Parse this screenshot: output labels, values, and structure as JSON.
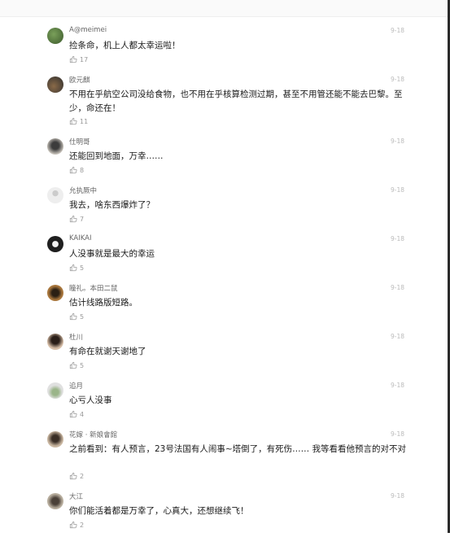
{
  "colors": {
    "like_icon": "#999999",
    "date": "#bbbbbb"
  },
  "comments": [
    {
      "user": "A@meimei",
      "date": "9-18",
      "text": "捡条命，机上人都太幸运啦！",
      "likes": "17",
      "avatar_colors": [
        "#7aa05a",
        "#3c5a2c"
      ]
    },
    {
      "user": "欧元麒",
      "date": "9-18",
      "text": "不用在乎航空公司没给食物，也不用在乎核算检测过期，甚至不用管还能不能去巴黎。至少，命还在！",
      "likes": "11",
      "avatar_colors": [
        "#2d2d2d",
        "#8a6a48"
      ]
    },
    {
      "user": "仕明哥",
      "date": "9-18",
      "text": "还能回到地面，万幸……",
      "likes": "8",
      "avatar_colors": [
        "#c8c3bb",
        "#3c3c3c"
      ]
    },
    {
      "user": "允执厥中",
      "date": "9-18",
      "text": "我去，啥东西爆炸了？",
      "likes": "7",
      "avatar_colors": [
        "#eeeeee",
        "#cccccc"
      ]
    },
    {
      "user": "KAIKAI",
      "date": "9-18",
      "text": "人没事就是最大的幸运",
      "likes": "5",
      "avatar_colors": [
        "#1f1f1f",
        "#f4f4f4"
      ]
    },
    {
      "user": "瞳礼。本田二鼠",
      "date": "9-18",
      "text": "估计线路版短路。",
      "likes": "5",
      "avatar_colors": [
        "#a8763c",
        "#2b2014"
      ]
    },
    {
      "user": "杜川",
      "date": "9-18",
      "text": "有命在就谢天谢地了",
      "likes": "5",
      "avatar_colors": [
        "#d8bfa8",
        "#2a1e18"
      ]
    },
    {
      "user": "追月",
      "date": "9-18",
      "text": "心亏人没事",
      "likes": "4",
      "avatar_colors": [
        "#e0e0e0",
        "#9bb58a"
      ]
    },
    {
      "user": "花嫁 · 新娘會館",
      "date": "9-18",
      "text": "之前看到：有人预言，23号法国有人闹事~塔倒了，有死伤…… 我等看看他预言的对不对",
      "likes": "2",
      "avatar_colors": [
        "#c9b6a0",
        "#3a2e26"
      ]
    },
    {
      "user": "大江",
      "date": "9-18",
      "text": "你们能活着都是万幸了，心真大，还想继续飞！",
      "likes": "2",
      "avatar_colors": [
        "#b8ae9e",
        "#4a4038"
      ]
    }
  ]
}
